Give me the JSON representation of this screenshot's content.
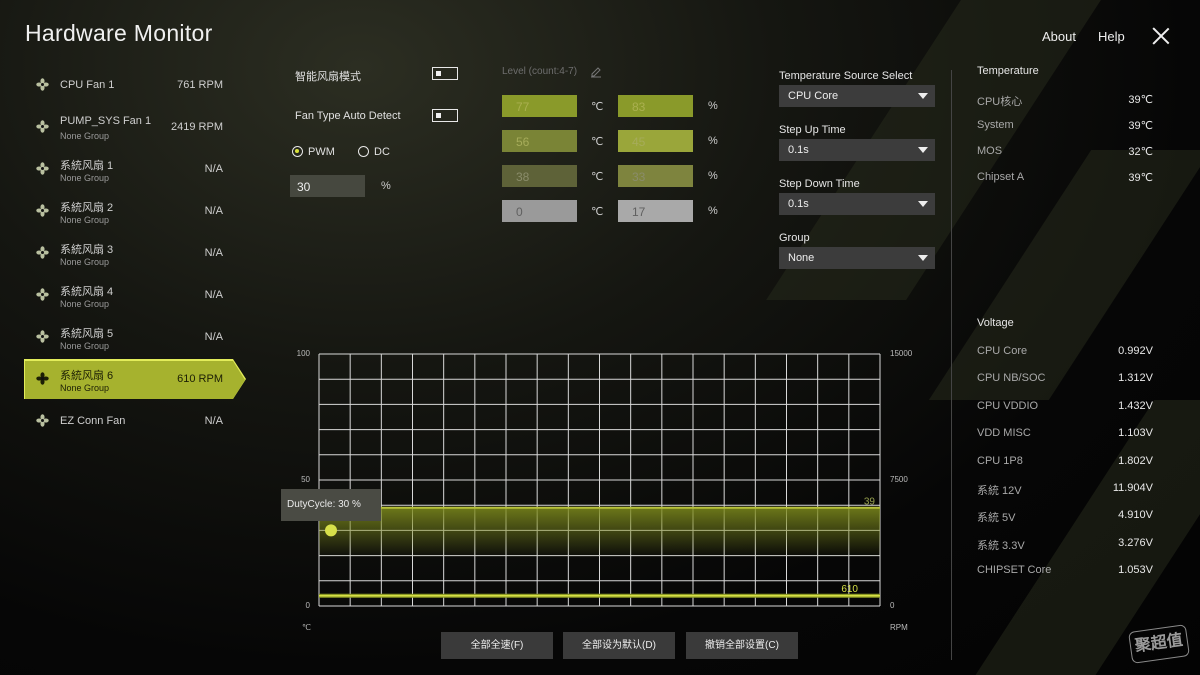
{
  "app": {
    "title": "Hardware Monitor",
    "nav": {
      "about": "About",
      "help": "Help"
    }
  },
  "fans": [
    {
      "name": "CPU Fan 1",
      "group": "",
      "value": "761 RPM"
    },
    {
      "name": "PUMP_SYS Fan 1",
      "group": "None Group",
      "value": "2419 RPM"
    },
    {
      "name": "系統风扇 1",
      "group": "None Group",
      "value": "N/A"
    },
    {
      "name": "系統风扇 2",
      "group": "None Group",
      "value": "N/A"
    },
    {
      "name": "系統风扇 3",
      "group": "None Group",
      "value": "N/A"
    },
    {
      "name": "系統风扇 4",
      "group": "None Group",
      "value": "N/A"
    },
    {
      "name": "系統风扇 5",
      "group": "None Group",
      "value": "N/A"
    },
    {
      "name": "系統风扇 6",
      "group": "None Group",
      "value": "610 RPM"
    },
    {
      "name": "EZ Conn Fan",
      "group": "",
      "value": "N/A"
    }
  ],
  "settings": {
    "smart_fan_label": "智能风扇模式",
    "auto_detect_label": "Fan Type Auto Detect",
    "pwm_label": "PWM",
    "dc_label": "DC",
    "mode_selected": "PWM",
    "duty_value": "30",
    "duty_unit": "%",
    "level_label": "Level (count:4-7)"
  },
  "levels": [
    {
      "temp": "77",
      "percent": "83"
    },
    {
      "temp": "56",
      "percent": "45"
    },
    {
      "temp": "38",
      "percent": "33"
    },
    {
      "temp": "0",
      "percent": "17"
    }
  ],
  "units": {
    "celsius": "℃",
    "percent": "%"
  },
  "selects": {
    "temp_source": {
      "label": "Temperature Source Select",
      "value": "CPU Core"
    },
    "step_up": {
      "label": "Step Up Time",
      "value": "0.1s"
    },
    "step_down": {
      "label": "Step Down Time",
      "value": "0.1s"
    },
    "group": {
      "label": "Group",
      "value": "None"
    }
  },
  "temperature": {
    "heading": "Temperature",
    "rows": [
      {
        "name": "CPU核心",
        "value": "39℃"
      },
      {
        "name": "System",
        "value": "39℃"
      },
      {
        "name": "MOS",
        "value": "32℃"
      },
      {
        "name": "Chipset A",
        "value": "39℃"
      }
    ]
  },
  "voltage": {
    "heading": "Voltage",
    "rows": [
      {
        "name": "CPU Core",
        "value": "0.992V"
      },
      {
        "name": "CPU NB/SOC",
        "value": "1.312V"
      },
      {
        "name": "CPU VDDIO",
        "value": "1.432V"
      },
      {
        "name": "VDD MISC",
        "value": "1.103V"
      },
      {
        "name": "CPU 1P8",
        "value": "1.802V"
      },
      {
        "name": "系統 12V",
        "value": "11.904V"
      },
      {
        "name": "系統 5V",
        "value": "4.910V"
      },
      {
        "name": "系統 3.3V",
        "value": "3.276V"
      },
      {
        "name": "CHIPSET Core",
        "value": "1.053V"
      }
    ]
  },
  "chart": {
    "left_ticks": [
      "100",
      "50",
      "0"
    ],
    "right_ticks": [
      "15000",
      "7500",
      "0"
    ],
    "left_unit": "℃",
    "right_unit": "RPM",
    "temp_line_label": "39",
    "rpm_line_label": "610",
    "tooltip": "DutyCycle: 30 %"
  },
  "chart_data": {
    "type": "line",
    "left_axis_range": [
      0,
      100
    ],
    "right_axis_range": [
      0,
      15000
    ],
    "temperature_c": 39,
    "rpm": 610,
    "duty_cycle_percent": 30
  },
  "buttons": {
    "full_speed": "全部全速(F)",
    "default_all": "全部设为默认(D)",
    "undo_all": "撤销全部设置(C)"
  },
  "watermark": "聚超值",
  "colors": {
    "accent": "#a6b22e",
    "accent_light": "#d9e23a"
  }
}
